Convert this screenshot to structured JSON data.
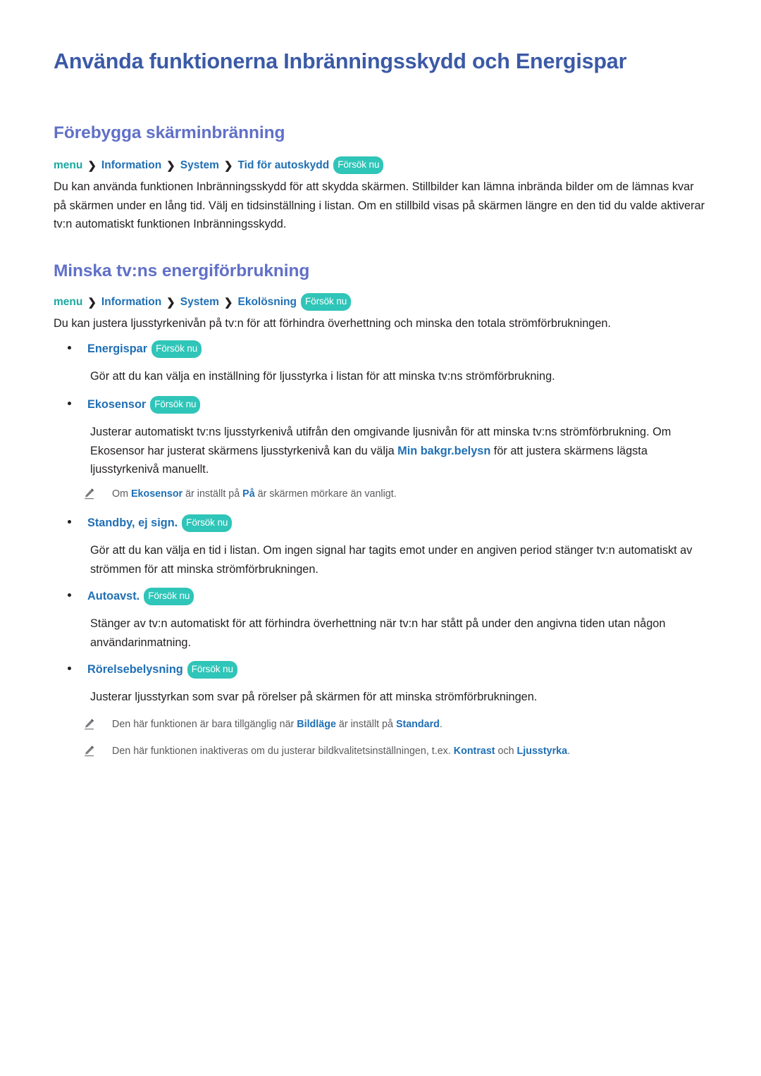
{
  "document": {
    "title": "Använda funktionerna Inbränningsskydd och Energispar",
    "try_now_label": "Försök nu",
    "colors": {
      "title": "#3b5aa6",
      "heading": "#6070c8",
      "crumb_root": "#1aa8a0",
      "crumb": "#1f6fb5",
      "badge": "#2fc5b8",
      "body": "#231f20",
      "note": "#5b5b5f"
    }
  },
  "sections": [
    {
      "heading": "Förebygga skärminbränning",
      "breadcrumb": {
        "root": "menu",
        "separator": "❯",
        "items": [
          "Information",
          "System",
          "Tid för autoskydd"
        ],
        "badge": "Försök nu"
      },
      "paragraph": "Du kan använda funktionen Inbränningsskydd för att skydda skärmen. Stillbilder kan lämna inbrända bilder om de lämnas kvar på skärmen under en lång tid. Välj en tidsinställning i listan. Om en stillbild visas på skärmen längre en den tid du valde aktiverar tv:n automatiskt funktionen Inbränningsskydd."
    },
    {
      "heading": "Minska tv:ns energiförbrukning",
      "breadcrumb": {
        "root": "menu",
        "separator": "❯",
        "items": [
          "Information",
          "System",
          "Ekolösning"
        ],
        "badge": "Försök nu"
      },
      "paragraph": "Du kan justera ljusstyrkenivån på tv:n för att förhindra överhettning och minska den totala strömförbrukningen."
    }
  ],
  "bullets": [
    {
      "label": "Energispar",
      "badge": "Försök nu",
      "description": "Gör att du kan välja en inställning för ljusstyrka i listan för att minska tv:ns strömförbrukning."
    },
    {
      "label": "Ekosensor",
      "badge": "Försök nu",
      "description_part1": "Justerar automatiskt tv:ns ljusstyrkenivå utifrån den omgivande ljusnivån för att minska tv:ns strömförbrukning. Om Ekosensor har justerat skärmens ljusstyrkenivå kan du välja ",
      "description_strong": "Min bakgr.belysn",
      "description_part2": " för att justera skärmens lägsta ljusstyrkenivå manuellt."
    },
    {
      "label": "Standby, ej sign.",
      "badge": "Försök nu",
      "description": "Gör att du kan välja en tid i listan. Om ingen signal har tagits emot under en angiven period stänger tv:n automatiskt av strömmen för att minska strömförbrukningen."
    },
    {
      "label": "Autoavst.",
      "badge": "Försök nu",
      "description": "Stänger av tv:n automatiskt för att förhindra överhettning när tv:n har stått på under den angivna tiden utan någon användarinmatning."
    },
    {
      "label": "Rörelsebelysning",
      "badge": "Försök nu",
      "description": "Justerar ljusstyrkan som svar på rörelser på skärmen för att minska strömförbrukningen."
    }
  ],
  "notes": [
    {
      "icon": "pencil-icon",
      "part1": "Om ",
      "strong1": "Ekosensor",
      "part2": " är inställt på ",
      "strong2": "På",
      "part3": " är skärmen mörkare än vanligt."
    },
    {
      "icon": "pencil-icon",
      "part1": "Den här funktionen är bara tillgänglig när ",
      "strong1": "Bildläge",
      "part2": " är inställt på ",
      "strong2": "Standard",
      "part3": "."
    },
    {
      "icon": "pencil-icon",
      "part1": "Den här funktionen inaktiveras om du justerar bildkvalitetsinställningen, t.ex. ",
      "strong1": "Kontrast",
      "part2": " och ",
      "strong2": "Ljusstyrka",
      "part3": "."
    }
  ]
}
